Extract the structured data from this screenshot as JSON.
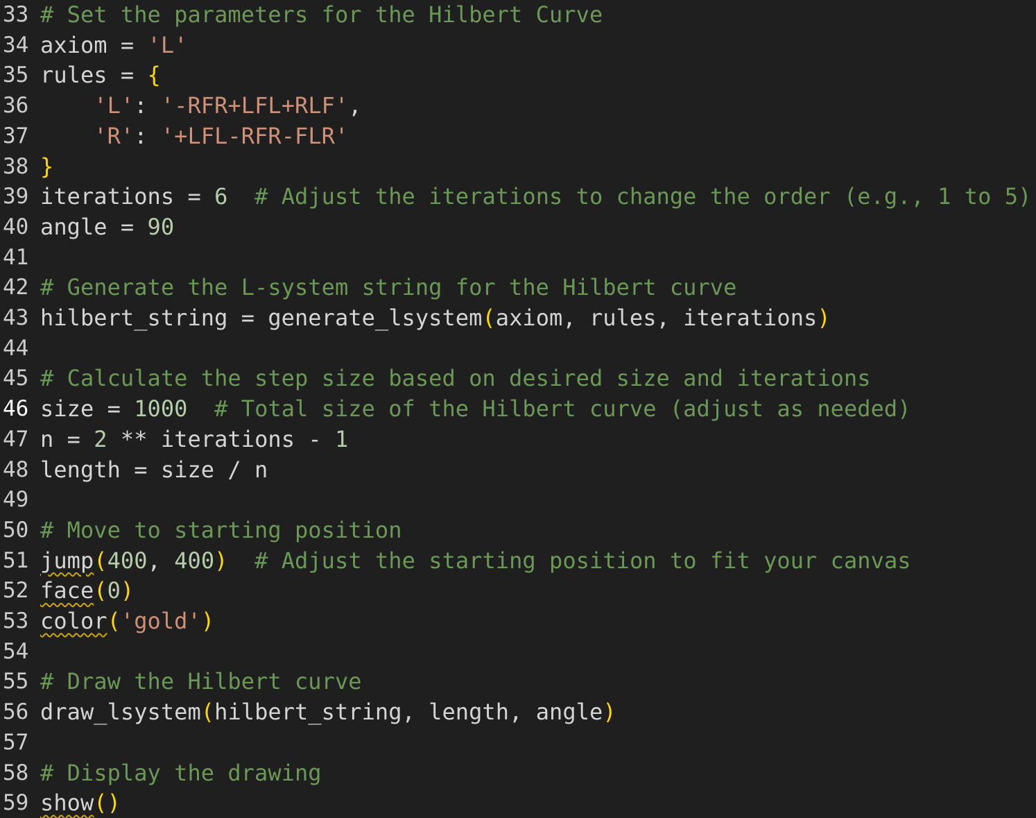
{
  "editor": {
    "colors": {
      "background": "#1f1f1f",
      "text": "#d4d4d4",
      "comment": "#6a9955",
      "string": "#ce9178",
      "number": "#b5cea8",
      "bracket": "#ffd700",
      "warning_squiggle": "#cca700"
    },
    "active_line": 46,
    "lines": [
      {
        "n": 33,
        "tokens": [
          {
            "t": "# Set the parameters for the Hilbert Curve",
            "k": "comment"
          }
        ]
      },
      {
        "n": 34,
        "tokens": [
          {
            "t": "axiom = ",
            "k": "plain"
          },
          {
            "t": "'L'",
            "k": "string"
          }
        ]
      },
      {
        "n": 35,
        "tokens": [
          {
            "t": "rules = ",
            "k": "plain"
          },
          {
            "t": "{",
            "k": "brace"
          }
        ]
      },
      {
        "n": 36,
        "tokens": [
          {
            "t": "    ",
            "k": "plain"
          },
          {
            "t": "'L'",
            "k": "string"
          },
          {
            "t": ": ",
            "k": "plain"
          },
          {
            "t": "'-RFR+LFL+RLF'",
            "k": "string"
          },
          {
            "t": ",",
            "k": "plain"
          }
        ]
      },
      {
        "n": 37,
        "tokens": [
          {
            "t": "    ",
            "k": "plain"
          },
          {
            "t": "'R'",
            "k": "string"
          },
          {
            "t": ": ",
            "k": "plain"
          },
          {
            "t": "'+LFL-RFR-FLR'",
            "k": "string"
          }
        ]
      },
      {
        "n": 38,
        "tokens": [
          {
            "t": "}",
            "k": "brace"
          }
        ]
      },
      {
        "n": 39,
        "tokens": [
          {
            "t": "iterations = ",
            "k": "plain"
          },
          {
            "t": "6",
            "k": "number"
          },
          {
            "t": "  ",
            "k": "plain"
          },
          {
            "t": "# Adjust the iterations to change the order (e.g., 1 to 5)",
            "k": "comment"
          }
        ]
      },
      {
        "n": 40,
        "tokens": [
          {
            "t": "angle = ",
            "k": "plain"
          },
          {
            "t": "90",
            "k": "number"
          }
        ]
      },
      {
        "n": 41,
        "tokens": []
      },
      {
        "n": 42,
        "tokens": [
          {
            "t": "# Generate the L-system string for the Hilbert curve",
            "k": "comment"
          }
        ]
      },
      {
        "n": 43,
        "tokens": [
          {
            "t": "hilbert_string = generate_lsystem",
            "k": "plain"
          },
          {
            "t": "(",
            "k": "brace"
          },
          {
            "t": "axiom, rules, iterations",
            "k": "plain"
          },
          {
            "t": ")",
            "k": "brace"
          }
        ]
      },
      {
        "n": 44,
        "tokens": []
      },
      {
        "n": 45,
        "tokens": [
          {
            "t": "# Calculate the step size based on desired size and iterations",
            "k": "comment"
          }
        ]
      },
      {
        "n": 46,
        "tokens": [
          {
            "t": "size = ",
            "k": "plain"
          },
          {
            "t": "1000",
            "k": "number"
          },
          {
            "t": "  ",
            "k": "plain"
          },
          {
            "t": "# Total size of the Hilbert curve (adjust as needed)",
            "k": "comment"
          }
        ]
      },
      {
        "n": 47,
        "tokens": [
          {
            "t": "n = ",
            "k": "plain"
          },
          {
            "t": "2",
            "k": "number"
          },
          {
            "t": " ** iterations - ",
            "k": "plain"
          },
          {
            "t": "1",
            "k": "number"
          }
        ]
      },
      {
        "n": 48,
        "tokens": [
          {
            "t": "length = size / n",
            "k": "plain"
          }
        ]
      },
      {
        "n": 49,
        "tokens": []
      },
      {
        "n": 50,
        "tokens": [
          {
            "t": "# Move to starting position",
            "k": "comment"
          }
        ]
      },
      {
        "n": 51,
        "tokens": [
          {
            "t": "jump",
            "k": "plain",
            "squiggle": true
          },
          {
            "t": "(",
            "k": "brace"
          },
          {
            "t": "400",
            "k": "number"
          },
          {
            "t": ", ",
            "k": "plain"
          },
          {
            "t": "400",
            "k": "number"
          },
          {
            "t": ")",
            "k": "brace"
          },
          {
            "t": "  ",
            "k": "plain"
          },
          {
            "t": "# Adjust the starting position to fit your canvas",
            "k": "comment"
          }
        ]
      },
      {
        "n": 52,
        "tokens": [
          {
            "t": "face",
            "k": "plain",
            "squiggle": true
          },
          {
            "t": "(",
            "k": "brace"
          },
          {
            "t": "0",
            "k": "number"
          },
          {
            "t": ")",
            "k": "brace"
          }
        ]
      },
      {
        "n": 53,
        "tokens": [
          {
            "t": "color",
            "k": "plain",
            "squiggle": true
          },
          {
            "t": "(",
            "k": "brace"
          },
          {
            "t": "'gold'",
            "k": "string"
          },
          {
            "t": ")",
            "k": "brace"
          }
        ]
      },
      {
        "n": 54,
        "tokens": []
      },
      {
        "n": 55,
        "tokens": [
          {
            "t": "# Draw the Hilbert curve",
            "k": "comment"
          }
        ]
      },
      {
        "n": 56,
        "tokens": [
          {
            "t": "draw_lsystem",
            "k": "plain"
          },
          {
            "t": "(",
            "k": "brace"
          },
          {
            "t": "hilbert_string, length, angle",
            "k": "plain"
          },
          {
            "t": ")",
            "k": "brace"
          }
        ]
      },
      {
        "n": 57,
        "tokens": []
      },
      {
        "n": 58,
        "tokens": [
          {
            "t": "# Display the drawing",
            "k": "comment"
          }
        ]
      },
      {
        "n": 59,
        "tokens": [
          {
            "t": "show",
            "k": "plain",
            "squiggle": true
          },
          {
            "t": "()",
            "k": "brace"
          }
        ]
      }
    ]
  }
}
